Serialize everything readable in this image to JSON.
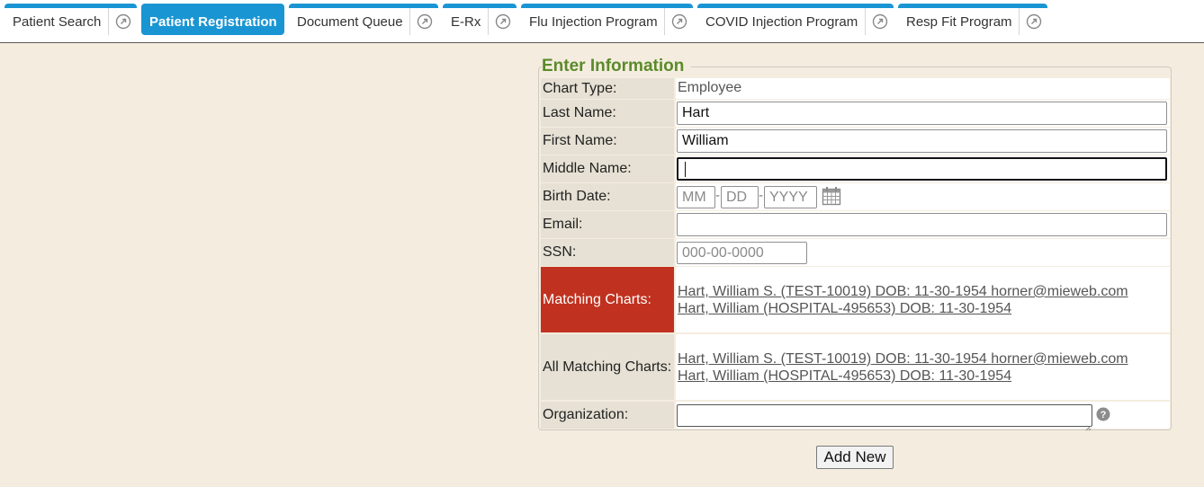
{
  "tabs": [
    {
      "label": "Patient Search"
    },
    {
      "label": "Patient Registration"
    },
    {
      "label": "Document Queue"
    },
    {
      "label": "E-Rx"
    },
    {
      "label": "Flu Injection Program"
    },
    {
      "label": "COVID Injection Program"
    },
    {
      "label": "Resp Fit Program"
    }
  ],
  "form": {
    "legend": "Enter Information",
    "chart_type": {
      "label": "Chart Type:",
      "value": "Employee"
    },
    "last_name": {
      "label": "Last Name:",
      "value": "Hart"
    },
    "first_name": {
      "label": "First Name:",
      "value": "William"
    },
    "middle_name": {
      "label": "Middle Name:",
      "value": ""
    },
    "birth_date": {
      "label": "Birth Date:",
      "mm": "MM",
      "dd": "DD",
      "yyyy": "YYYY",
      "sep": "-"
    },
    "email": {
      "label": "Email:",
      "value": ""
    },
    "ssn": {
      "label": "SSN:",
      "placeholder": "000-00-0000"
    },
    "matching": {
      "label": "Matching Charts:",
      "items": [
        "Hart, William S. (TEST-10019) DOB: 11-30-1954 horner@mieweb.com",
        "Hart, William (HOSPITAL-495653) DOB: 11-30-1954"
      ]
    },
    "all_matching": {
      "label": "All Matching Charts:",
      "items": [
        "Hart, William S. (TEST-10019) DOB: 11-30-1954 horner@mieweb.com",
        "Hart, William (HOSPITAL-495653) DOB: 11-30-1954"
      ]
    },
    "organization": {
      "label": "Organization:",
      "value": ""
    },
    "add_button": "Add New"
  },
  "colors": {
    "tab_accent": "#1a95d3",
    "legend_green": "#5b8a2a",
    "alert_red": "#c0321f",
    "page_bg": "#f4eddf"
  },
  "icons": [
    "popout-icon",
    "calendar-icon",
    "help-icon"
  ]
}
